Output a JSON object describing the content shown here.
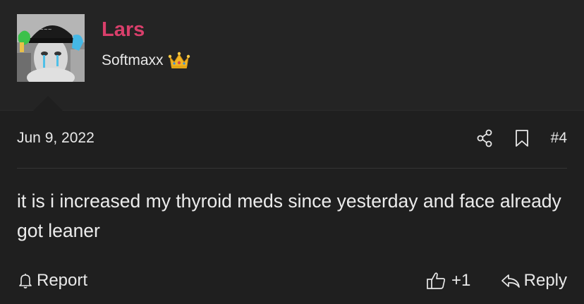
{
  "user": {
    "name": "Lars",
    "title": "Softmaxx",
    "title_icon": "crown-icon",
    "name_color": "#d93f6b"
  },
  "post": {
    "date": "Jun 9, 2022",
    "number": "#4",
    "message": "it is i increased my thyroid meds since yesterday and face already got leaner"
  },
  "actions": {
    "share_icon": "share-icon",
    "bookmark_icon": "bookmark-icon",
    "report_label": "Report",
    "react_label": "+1",
    "reply_label": "Reply"
  }
}
